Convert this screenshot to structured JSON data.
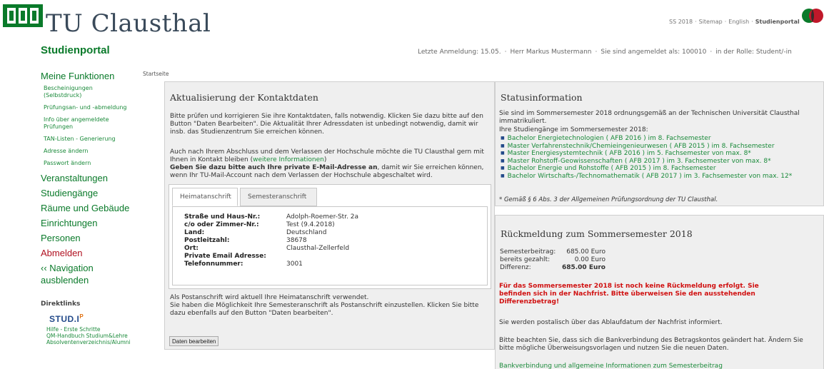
{
  "header": {
    "title": "TU Clausthal",
    "portal": "Studienportal",
    "topnav": [
      "SS 2018",
      "Sitemap",
      "English",
      "Studienportal"
    ],
    "login": [
      "Letzte Anmeldung: 15.05.",
      "Herr Markus Mustermann",
      "Sie sind angemeldet als: 100010",
      "in der Rolle: Student/-in"
    ]
  },
  "sidebar": {
    "heading": "Meine Funktionen",
    "sub": [
      "Bescheinigungen (Selbstdruck)",
      "Prüfungsan- und -abmeldung",
      "Info über angemeldete Prüfungen",
      "TAN-Listen - Generierung",
      "Adresse ändern",
      "Passwort ändern"
    ],
    "main": [
      "Veranstaltungen",
      "Studiengänge",
      "Räume und Gebäude",
      "Einrichtungen",
      "Personen"
    ],
    "logout": "Abmelden",
    "hide_nav": "‹‹ Navigation ausblenden",
    "direktlinks": "Direktlinks",
    "studip": "STUD.IP",
    "links": [
      "Hilfe - Erste Schritte",
      "QM-Handbuch Studium&Lehre",
      "Absolventenverzeichnis/Alumni"
    ]
  },
  "breadcrumb": "Startseite",
  "kontakt": {
    "title": "Aktualisierung der Kontaktdaten",
    "p1": "Bitte prüfen und korrigieren Sie ihre Kontaktdaten, falls notwendig. Klicken Sie dazu bitte auf den Button \"Daten Bearbeiten\". Die Aktualität Ihrer Adressdaten ist unbedingt notwendig, damit wir insb. das Studienzentrum Sie erreichen können.",
    "p2a": "Auch nach Ihrem Abschluss und dem Verlassen der Hochschule möchte die TU Clausthal gern mit Ihnen in Kontakt bleiben (",
    "p2link": "weitere Informationen",
    "p2b": ")",
    "p3bold": "Geben Sie dazu bitte auch Ihre private E-Mail-Adresse an",
    "p3rest": ", damit wir Sie erreichen können, wenn Ihr TU-Mail-Account nach dem Verlassen der Hochschule abgeschaltet wird.",
    "tabs": [
      "Heimatanschrift",
      "Semesteranschrift"
    ],
    "fields": [
      {
        "k": "Straße und Haus-Nr.:",
        "v": "Adolph-Roemer-Str. 2a"
      },
      {
        "k": "c/o oder Zimmer-Nr.:",
        "v": "Test (9.4.2018)"
      },
      {
        "k": "Land:",
        "v": "Deutschland"
      },
      {
        "k": "Postleitzahl:",
        "v": "38678"
      },
      {
        "k": "Ort:",
        "v": "Clausthal-Zellerfeld"
      },
      {
        "k": "Private Email Adresse:",
        "v": ""
      },
      {
        "k": "Telefonnummer:",
        "v": "3001"
      }
    ],
    "post1": "Als Postanschrift wird aktuell Ihre Heimatanschrift verwendet.",
    "post2": "Sie haben die Möglichkeit Ihre Semesteranschrift als Postanschrift einzustellen. Klicken Sie bitte dazu ebenfalls auf den Button \"Daten bearbeiten\".",
    "button": "Daten bearbeiten"
  },
  "status": {
    "title": "Statusinformation",
    "p1": "Sie sind im Sommersemester 2018 ordnungsgemäß an der Technischen Universität Clausthal immatrikuliert.",
    "p2": "Ihre Studiengänge im Sommersemester 2018:",
    "programs": [
      "Bachelor Energietechnologien ( AFB 2016 ) im 8. Fachsemester",
      "Master Verfahrenstechnik/Chemieingenieurwesen ( AFB 2015 ) im 8. Fachsemester",
      "Master Energiesystemtechnik ( AFB 2016 ) im 5. Fachsemester von max. 8*",
      "Master Rohstoff-Geowissenschaften ( AFB 2017 ) im 3. Fachsemester von max. 8*",
      "Bachelor Energie und Rohstoffe ( AFB 2015 ) im 8. Fachsemester",
      "Bachelor Wirtschafts-/Technomathematik ( AFB 2017 ) im 3. Fachsemester von max. 12*"
    ],
    "footnote": "* Gemäß § 6 Abs. 3 der Allgemeinen Prüfungsordnung der TU Clausthal."
  },
  "rueck": {
    "title": "Rückmeldung zum Sommersemester 2018",
    "fees": [
      {
        "lab": "Semesterbeitrag:",
        "val": "685.00 Euro"
      },
      {
        "lab": "bereits gezahlt:",
        "val": "0.00 Euro"
      },
      {
        "lab": "Differenz:",
        "val": "685.00 Euro"
      }
    ],
    "warning": "Für das Sommersemester 2018 ist noch keine Rückmeldung erfolgt. Sie befinden sich in der Nachfrist. Bitte überweisen Sie den ausstehenden Differenzbetrag!",
    "info1": "Sie werden postalisch über das Ablaufdatum der Nachfrist informiert.",
    "info2": "Bitte beachten Sie, dass sich die Bankverbindung des Betragskontos geändert hat. Ändern Sie bitte mögliche Überweisungsvorlagen und nutzen Sie die neuen Daten.",
    "link": "Bankverbindung und allgemeine Informationen zum Semesterbeitrag"
  }
}
